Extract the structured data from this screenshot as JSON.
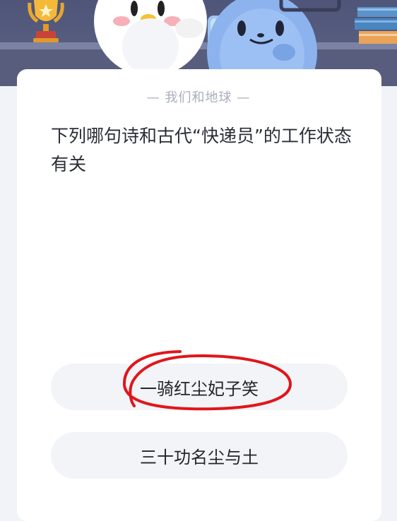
{
  "header": {
    "topic": "— 我们和地球 —",
    "icons": [
      "trophy-icon",
      "books-icon",
      "penguin-mascot",
      "blue-mascot"
    ]
  },
  "question": {
    "text": "下列哪句诗和古代“快递员”的工作状态有关"
  },
  "options": [
    {
      "label": "一骑红尘妃子笑",
      "annotated": true
    },
    {
      "label": "三十功名尘与土",
      "annotated": false
    }
  ],
  "colors": {
    "card_bg": "#ffffff",
    "option_bg": "#f2f4f7",
    "scene_bg": "#555a7d",
    "annotation": "#e0161b"
  }
}
